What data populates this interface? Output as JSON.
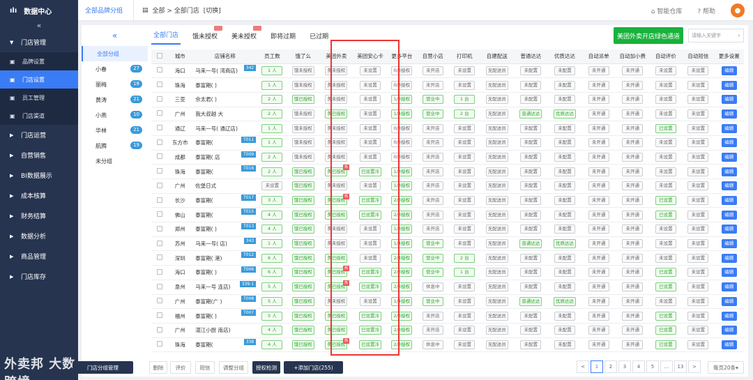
{
  "app": {
    "title": "数据中心"
  },
  "sidebar": {
    "collapse": "«",
    "sections": [
      {
        "label": "门店管理",
        "open": true,
        "children": [
          {
            "label": "品牌设置",
            "icon": "crown-icon"
          },
          {
            "label": "门店设置",
            "icon": "store-icon",
            "active": true
          },
          {
            "label": "员工管理",
            "icon": "user-card-icon"
          },
          {
            "label": "门店渠道",
            "icon": "channel-icon"
          }
        ]
      },
      {
        "label": "门店运营"
      },
      {
        "label": "自营销售"
      },
      {
        "label": "BI数据展示"
      },
      {
        "label": "成本核算"
      },
      {
        "label": "财务结算"
      },
      {
        "label": "数据分析"
      },
      {
        "label": "商品管理"
      },
      {
        "label": "门店库存"
      }
    ],
    "watermark": "外卖邦 大数跨境"
  },
  "topbar": {
    "brand_group": "全部品牌分组",
    "breadcrumb": "全部 > 全部门店",
    "switch": "[切换]",
    "warehouse": "智能仓库",
    "help": "帮助"
  },
  "groups": {
    "collapse": "«",
    "items": [
      {
        "label": "全部分组",
        "active": true
      },
      {
        "label": "小春",
        "count": "27"
      },
      {
        "label": "丽梅",
        "count": "18"
      },
      {
        "label": "黄涛",
        "count": "21"
      },
      {
        "label": "小燕",
        "count": "10"
      },
      {
        "label": "华林",
        "count": "21"
      },
      {
        "label": "航腾",
        "count": "19"
      },
      {
        "label": "未分组"
      }
    ]
  },
  "tabs": [
    {
      "label": "全部门店",
      "active": true
    },
    {
      "label": "饿未授权",
      "mark": true
    },
    {
      "label": "美未授权",
      "mark": true
    },
    {
      "label": "即将过期"
    },
    {
      "label": "已过期"
    }
  ],
  "green_button": "美团外卖开店绿色通道",
  "search": {
    "placeholder": "请输入关键字"
  },
  "table": {
    "headers": [
      "城市",
      "店铺名称",
      "员工数",
      "饿了么",
      "美团外卖",
      "美团安心卡",
      "更多平台",
      "自营小店",
      "打印机",
      "自建配送",
      "普通达达",
      "优质达达",
      "自动派单",
      "自动加小费",
      "自动评价",
      "自动短信",
      "更多设置"
    ],
    "rows": [
      [
        "海口",
        "马来一号(      湾商店)",
        "342",
        "1 人",
        "饿未授权",
        "美未授权",
        "",
        "未设置",
        "0/3授权",
        "未开店",
        "未设置",
        "无配送员",
        "未配置",
        "未配置",
        "未开通",
        "未开通",
        "未设置",
        "未设置",
        "编辑"
      ],
      [
        "珠海",
        "泰富期(      )",
        "",
        "1 人",
        "饿未授权",
        "美未授权",
        "",
        "未设置",
        "0/3授权",
        "未开店",
        "未设置",
        "无配送员",
        "未配置",
        "未配置",
        "未开通",
        "未开通",
        "未设置",
        "未设置",
        "编辑"
      ],
      [
        "三亚",
        "佘太君(      )",
        "",
        "2 人",
        "饿已授权",
        "美未授权",
        "",
        "未设置",
        "1/3授权",
        "营业中",
        "1 台",
        "无配送员",
        "未配置",
        "未配置",
        "未开通",
        "未开通",
        "未设置",
        "未设置",
        "编辑"
      ],
      [
        "广州",
        "我大叔越      大",
        "",
        "2 人",
        "饿未授权",
        "美已授权",
        "",
        "未设置",
        "1/4授权",
        "营业中",
        "2 台",
        "无配送员",
        "普通达达",
        "优质达达",
        "未开通",
        "未开通",
        "未设置",
        "未设置",
        "编辑"
      ],
      [
        "通辽",
        "马来一号(      通辽店)",
        "",
        "1 人",
        "饿未授权",
        "美未授权",
        "",
        "未设置",
        "0/3授权",
        "未开店",
        "未设置",
        "无配送员",
        "未配置",
        "未配置",
        "未开通",
        "未开通",
        "已设置",
        "未设置",
        "编辑"
      ],
      [
        "东方市",
        "泰富期(      ",
        "T011",
        "1 人",
        "饿未授权",
        "美未授权",
        "",
        "未设置",
        "0/3授权",
        "未开店",
        "未设置",
        "无配送员",
        "未配置",
        "未配置",
        "未开通",
        "未开通",
        "未设置",
        "未设置",
        "编辑"
      ],
      [
        "成都",
        "泰富期(      店",
        "T009",
        "2 人",
        "饿未授权",
        "美未授权",
        "",
        "未设置",
        "0/3授权",
        "未开店",
        "未设置",
        "无配送员",
        "未配置",
        "未配置",
        "未开通",
        "未开通",
        "未设置",
        "未设置",
        "编辑"
      ],
      [
        "珠海",
        "泰富期(      ",
        "T016",
        "2 人",
        "饿已授权",
        "美已授权",
        "hot",
        "已设置|冷",
        "1/3授权",
        "未开店",
        "未设置",
        "无配送员",
        "未配置",
        "未配置",
        "未开通",
        "未开通",
        "未设置",
        "未设置",
        "编辑"
      ],
      [
        "广州",
        "佐堡日式      ",
        "",
        "未设置",
        "饿已授权",
        "美未授权",
        "",
        "未设置",
        "1/3授权",
        "未开店",
        "未设置",
        "无配送员",
        "未配置",
        "未配置",
        "未开通",
        "未开通",
        "未设置",
        "未设置",
        "编辑"
      ],
      [
        "长沙",
        "泰富期(      ",
        "T017",
        "3 人",
        "饿已授权",
        "美已授权",
        "hot",
        "已设置|冷",
        "2/3授权",
        "未开店",
        "未设置",
        "无配送员",
        "未配置",
        "未配置",
        "未开通",
        "未开通",
        "已设置",
        "未设置",
        "编辑"
      ],
      [
        "佛山",
        "泰富期(      ",
        "T015",
        "4 人",
        "饿已授权",
        "美已授权",
        "",
        "已设置|冷",
        "2/3授权",
        "未开店",
        "未设置",
        "无配送员",
        "未配置",
        "未配置",
        "未开通",
        "未开通",
        "已设置",
        "未设置",
        "编辑"
      ],
      [
        "郑州",
        "泰富期(      )",
        "T013",
        "4 人",
        "饿已授权",
        "美未授权",
        "",
        "未设置",
        "1/3授权",
        "未开店",
        "未设置",
        "无配送员",
        "未配置",
        "未配置",
        "未开通",
        "未开通",
        "未设置",
        "未设置",
        "编辑"
      ],
      [
        "苏州",
        "马来一号(      店)",
        "343",
        "1 人",
        "饿已授权",
        "美未授权",
        "",
        "未设置",
        "1/4授权",
        "营业中",
        "未设置",
        "无配送员",
        "普通达达",
        "优质达达",
        "未开通",
        "未开通",
        "未设置",
        "未设置",
        "编辑"
      ],
      [
        "深圳",
        "泰富期(      港)",
        "T012",
        "6 人",
        "饿已授权",
        "美已授权",
        "",
        "未设置",
        "2/4授权",
        "营业中",
        "2 台",
        "无配送员",
        "未配置",
        "未配置",
        "未开通",
        "未开通",
        "未设置",
        "未设置",
        "编辑"
      ],
      [
        "海口",
        "泰富期(      )",
        "T006",
        "6 人",
        "饿已授权",
        "美已授权",
        "hot",
        "已设置|冷",
        "2/3授权",
        "营业中",
        "1 台",
        "无配送员",
        "未配置",
        "未配置",
        "未开通",
        "未开通",
        "已设置",
        "未设置",
        "编辑"
      ],
      [
        "泉州",
        "马来一号      连店)",
        "339-1",
        "5 人",
        "饿已授权",
        "美已授权",
        "hot",
        "已设置|冷",
        "2/3授权",
        "休息中",
        "未设置",
        "无配送员",
        "未配置",
        "未配置",
        "未开通",
        "未开通",
        "已设置",
        "未设置",
        "编辑"
      ],
      [
        "广州",
        "泰富期(广      )",
        "T008",
        "5 人",
        "饿已授权",
        "美未授权",
        "",
        "未设置",
        "1/4授权",
        "营业中",
        "未设置",
        "无配送员",
        "普通达达",
        "优质达达",
        "未开通",
        "未开通",
        "未设置",
        "未设置",
        "编辑"
      ],
      [
        "福州",
        "泰富期(      )",
        "T007",
        "5 人",
        "饿已授权",
        "美已授权",
        "",
        "已设置|冷",
        "2/3授权",
        "未开店",
        "未设置",
        "无配送员",
        "未配置",
        "未配置",
        "未开通",
        "未开通",
        "已设置",
        "未设置",
        "编辑"
      ],
      [
        "广州",
        "湛江小厨      南店)",
        "",
        "4 人",
        "饿已授权",
        "美已授权",
        "",
        "已设置|冷",
        "2/3授权",
        "未开店",
        "未设置",
        "无配送员",
        "未配置",
        "未配置",
        "未开通",
        "未开通",
        "已设置",
        "未设置",
        "编辑"
      ],
      [
        "珠海",
        "泰富期(      ",
        "338",
        "4 人",
        "饿已授权",
        "美已授权",
        "hot",
        "已设置|冷",
        "2/3授权",
        "休息中",
        "未设置",
        "无配送员",
        "未配置",
        "未配置",
        "未开通",
        "未开通",
        "已设置",
        "未设置",
        "编辑"
      ]
    ]
  },
  "footer": {
    "group_btn": "门店分组管理",
    "buttons": [
      "删除",
      "评价",
      "短信",
      "调整分组",
      "授权检测",
      "+添加门店(255)"
    ],
    "pages": [
      "<",
      "1",
      "2",
      "3",
      "4",
      "5",
      "...",
      "13",
      ">"
    ],
    "per_page": "每页20条"
  },
  "colors": {
    "accent": "#3a7cf5",
    "sidebar": "#263450",
    "green": "#19b23b",
    "highlight": "#e33"
  }
}
